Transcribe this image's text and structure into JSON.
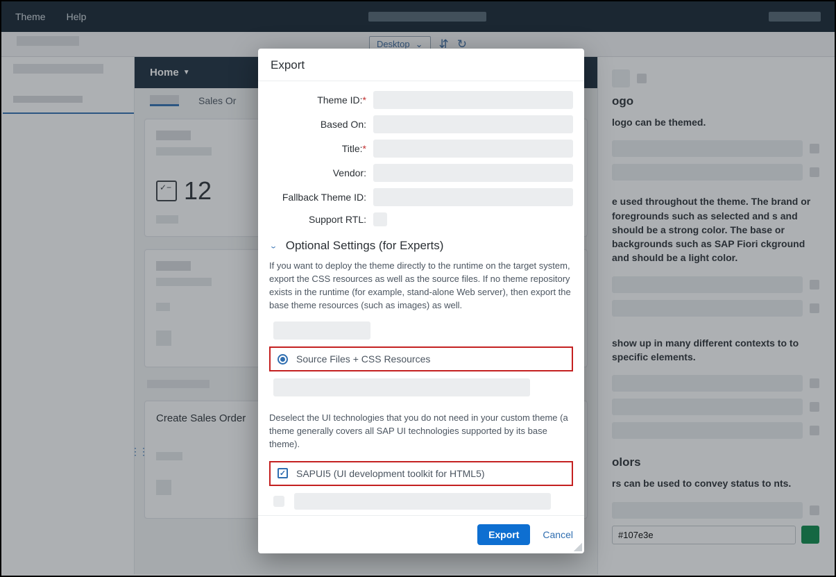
{
  "topbar": {
    "theme": "Theme",
    "help": "Help"
  },
  "subbar": {
    "device": "Desktop"
  },
  "mid": {
    "home_tab": "Home",
    "tab2": "Sales Or",
    "big_number": "12",
    "card3_title": "Create Sales Order"
  },
  "right": {
    "h1": "ogo",
    "p1": "logo can be themed.",
    "p2": "e used throughout the theme. The brand or foregrounds such as selected and s and should be a strong color. The base or backgrounds such as SAP Fiori ckground and should be a light color.",
    "p3": " show up in many different contexts to  to specific elements.",
    "h4": "olors",
    "p4": "rs can be used to convey status to nts.",
    "hex": "#107e3e"
  },
  "dialog": {
    "title": "Export",
    "labels": {
      "theme_id": "Theme ID:",
      "based_on": "Based On:",
      "title": "Title:",
      "vendor": "Vendor:",
      "fallback": "Fallback Theme ID:",
      "rtl": "Support RTL:"
    },
    "section_title": "Optional Settings (for Experts)",
    "para1": "If you want to deploy the theme directly to the runtime on the target system, export the CSS resources as well as the source files. If no theme repository exists in the runtime (for example, stand-alone Web server), then export the base theme resources (such as images) as well.",
    "radio1": "Source Files + CSS Resources",
    "para2": "Deselect the UI technologies that you do not need in your custom theme (a theme generally covers all SAP UI technologies supported by its base theme).",
    "check1": "SAPUI5 (UI development toolkit for HTML5)",
    "export_btn": "Export",
    "cancel_btn": "Cancel"
  }
}
